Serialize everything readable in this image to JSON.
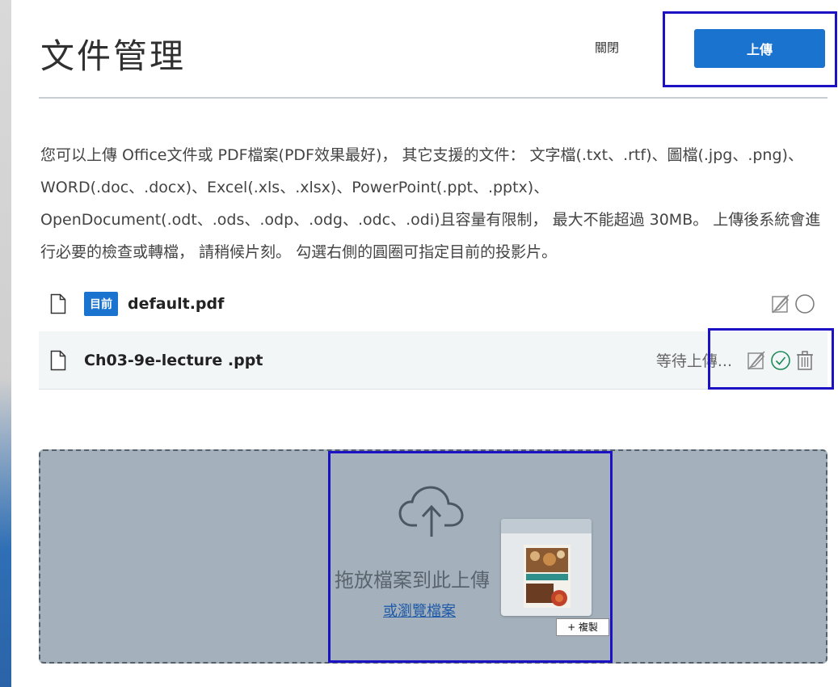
{
  "modal": {
    "title": "文件管理",
    "close_label": "關閉",
    "upload_label": "上傳"
  },
  "description": "您可以上傳 Office文件或 PDF檔案(PDF效果最好)， 其它支援的文件： 文字檔(.txt、.rtf)、圖檔(.jpg、.png)、WORD(.doc、.docx)、Excel(.xls、.xlsx)、PowerPoint(.ppt、.pptx)、OpenDocument(.odt、.ods、.odp、.odg、.odc、.odi)且容量有限制， 最大不能超過 30MB。 上傳後系統會進行必要的檢查或轉檔， 請稍候片刻。 勾選右側的圓圈可指定目前的投影片。",
  "files": [
    {
      "badge": "目前",
      "name": "default.pdf",
      "status": "",
      "selected": false
    },
    {
      "badge": "",
      "name": "Ch03-9e-lecture .ppt",
      "status": "等待上傳...",
      "selected": true
    }
  ],
  "dropzone": {
    "label": "拖放檔案到此上傳",
    "browse_link": "或瀏覽檔案",
    "copy_tag": "+ 複製"
  },
  "icons": {
    "file": "file-icon",
    "edit": "edit-disabled-icon",
    "radio": "radio-circle-icon",
    "check": "check-circle-icon",
    "trash": "trash-icon",
    "cloud": "cloud-upload-icon"
  },
  "colors": {
    "accent": "#1a73cf",
    "highlight": "#1c12c4",
    "dropzone_bg": "#a4b1bd",
    "check_green": "#1e8a5b"
  }
}
